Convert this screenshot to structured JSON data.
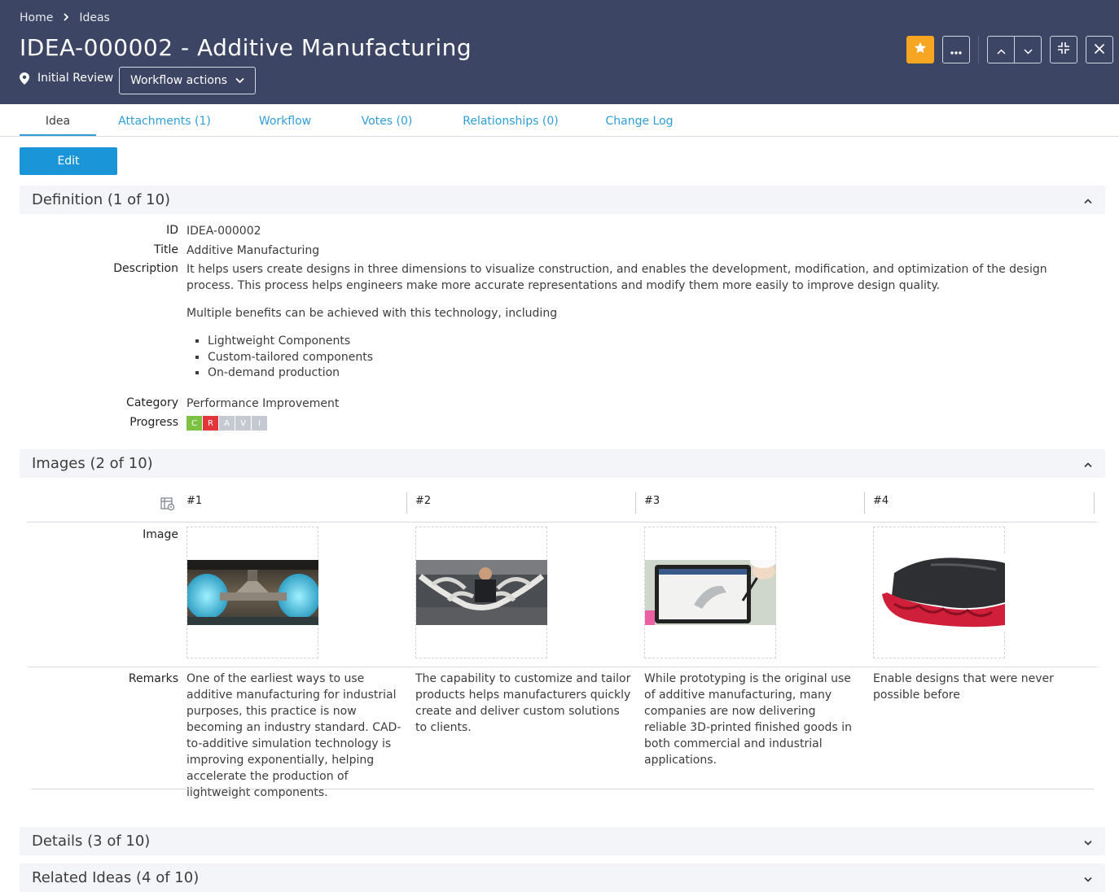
{
  "breadcrumb": {
    "home": "Home",
    "current": "Ideas"
  },
  "title": "IDEA-000002 - Additive Manufacturing",
  "state": "Initial Review",
  "workflow_actions": "Workflow actions",
  "header_icons": [
    "star-icon",
    "more-icon",
    "chevron-up-icon",
    "chevron-down-icon",
    "collapse-icon",
    "close-icon"
  ],
  "tabs": [
    {
      "label": "Idea",
      "active": true
    },
    {
      "label": "Attachments (1)"
    },
    {
      "label": "Workflow"
    },
    {
      "label": "Votes (0)"
    },
    {
      "label": "Relationships (0)"
    },
    {
      "label": "Change Log"
    }
  ],
  "edit_label": "Edit",
  "sections": {
    "definition": "Definition (1 of 10)",
    "images": "Images (2 of 10)",
    "details": "Details (3 of 10)",
    "related": "Related Ideas (4 of 10)"
  },
  "fields": {
    "id_label": "ID",
    "id_value": "IDEA-000002",
    "title_label": "Title",
    "title_value": "Additive Manufacturing",
    "description_label": "Description",
    "description_p1": "It helps users create designs in three dimensions to visualize construction, and enables the development, modification, and optimization of the design process. This process helps engineers make more accurate representations and modify them more easily to improve design quality.",
    "description_p2": "Multiple benefits can be achieved with this technology, including",
    "bullets": [
      "Lightweight Components",
      "Custom-tailored components",
      "On-demand production"
    ],
    "category_label": "Category",
    "category_value": "Performance Improvement",
    "progress_label": "Progress",
    "progress": [
      {
        "letter": "C",
        "color": "#7cc242"
      },
      {
        "letter": "R",
        "color": "#e3363a"
      },
      {
        "letter": "A",
        "color": "#c5cad2"
      },
      {
        "letter": "V",
        "color": "#c5cad2"
      },
      {
        "letter": "I",
        "color": "#c5cad2"
      }
    ]
  },
  "images": {
    "image_label": "Image",
    "remarks_label": "Remarks",
    "columns": [
      "#1",
      "#2",
      "#3",
      "#4"
    ],
    "remarks": [
      "One of the earliest ways to use additive manufacturing for industrial purposes, this practice is now becoming an industry standard. CAD-to-additive simulation technology is improving exponentially, helping accelerate the production of lightweight components.",
      "The capability to customize and tailor products helps manufacturers quickly create and deliver custom solutions to clients.",
      "While prototyping is the original use of additive manufacturing, many companies are now delivering reliable 3D-printed finished goods in both commercial and industrial applications.",
      "Enable designs that were never possible before"
    ]
  }
}
